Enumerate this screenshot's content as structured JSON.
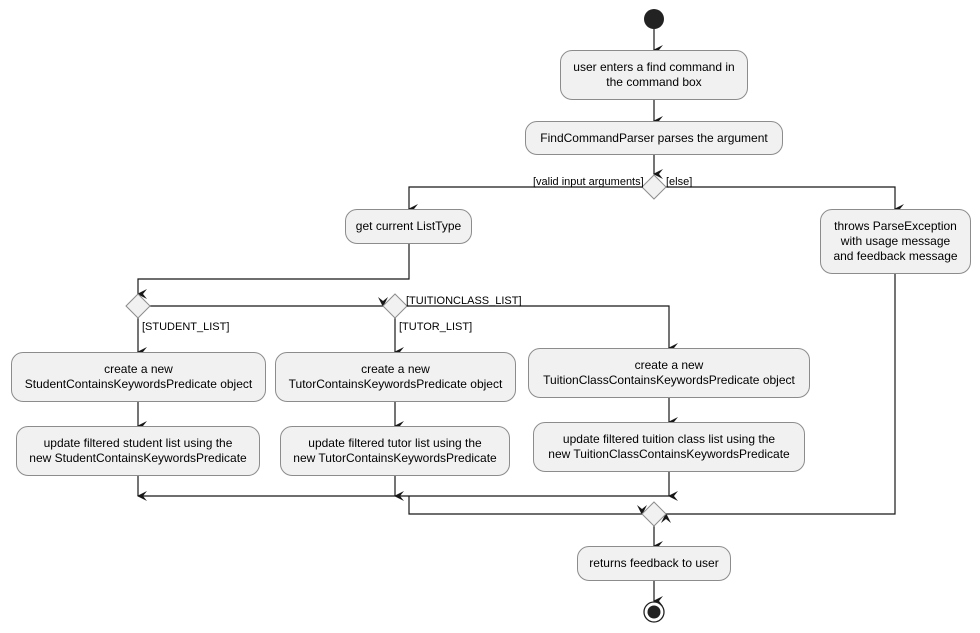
{
  "diagram": {
    "type": "activity",
    "colors": {
      "fill": "#f1f1f1",
      "border": "#8c8c8c",
      "line": "#181818",
      "node_dot": "#222222"
    },
    "actions": {
      "enter_command": "user enters a find command in\nthe command box",
      "parse": "FindCommandParser parses the argument",
      "get_list_type": "get current ListType",
      "throw_exception": "throws ParseException\nwith usage message\nand feedback message",
      "create_student": "create a new\nStudentContainsKeywordsPredicate object",
      "update_student": "update filtered student list using the\nnew StudentContainsKeywordsPredicate",
      "create_tutor": "create a new\nTutorContainsKeywordsPredicate object",
      "update_tutor": "update filtered tutor list using the\nnew TutorContainsKeywordsPredicate",
      "create_tuition": "create a new\nTuitionClassContainsKeywordsPredicate object",
      "update_tuition": "update filtered tuition class list using the\nnew TuitionClassContainsKeywordsPredicate",
      "return_feedback": "returns feedback to user"
    },
    "guards": {
      "valid": "[valid input arguments]",
      "else": "[else]",
      "student": "[STUDENT_LIST]",
      "tutor": "[TUTOR_LIST]",
      "tuition": "[TUITIONCLASS_LIST]"
    }
  }
}
